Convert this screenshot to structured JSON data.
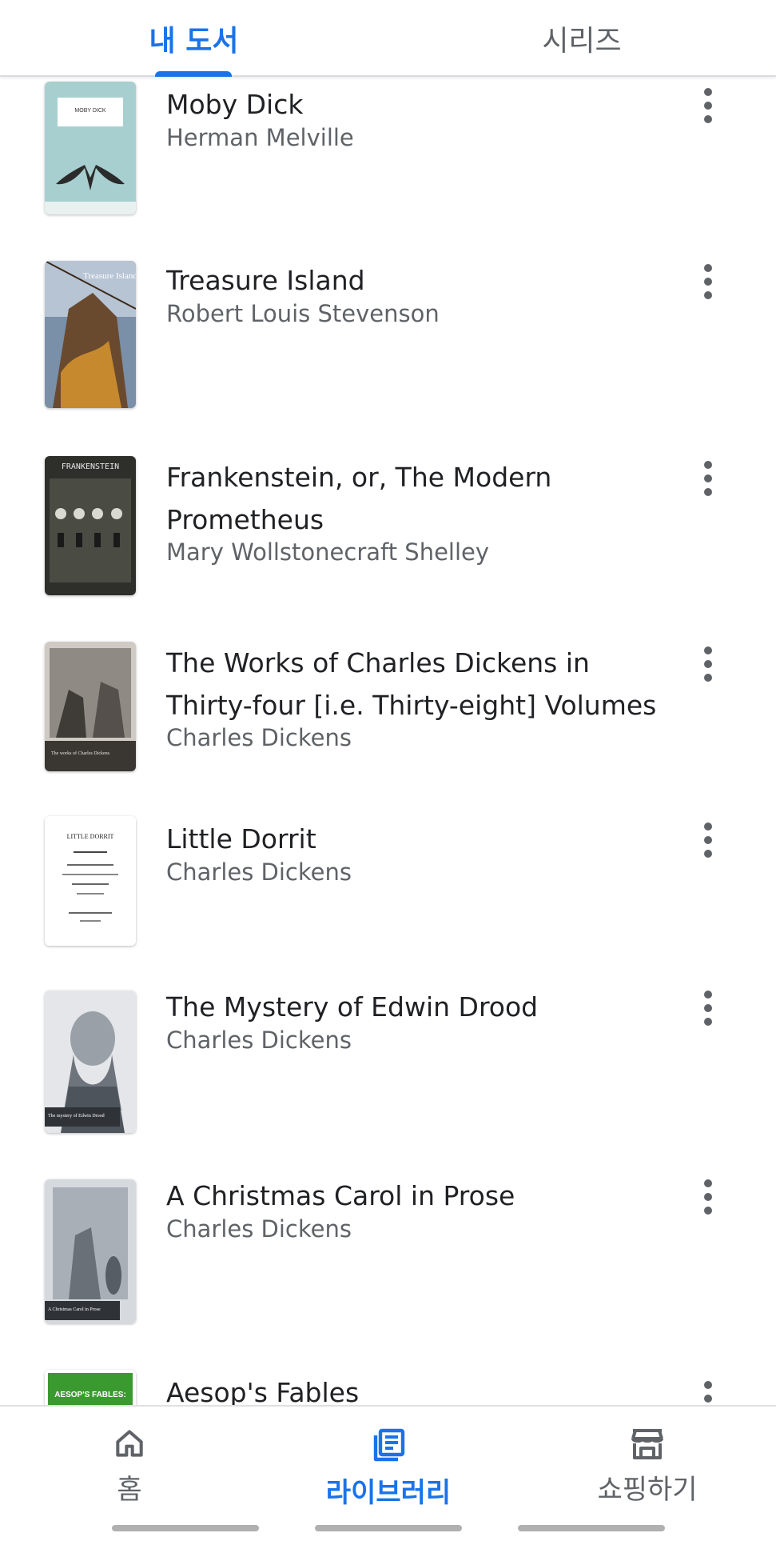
{
  "tabs": {
    "mine": "내 도서",
    "series": "시리즈"
  },
  "books": [
    {
      "title": "Moby Dick",
      "author": "Herman Melville",
      "cover_text": "MOBY DICK"
    },
    {
      "title": "Treasure Island",
      "author": "Robert Louis Stevenson",
      "cover_text": "Treasure Island"
    },
    {
      "title": "Frankenstein, or, The Modern Prometheus",
      "author": "Mary Wollstonecraft Shelley",
      "cover_text": "FRANKENSTEIN"
    },
    {
      "title": "The Works of Charles Dickens in Thirty-four [i.e. Thirty-eight] Volumes",
      "author": "Charles Dickens",
      "cover_text": "The works of Charles Dickens"
    },
    {
      "title": "Little Dorrit",
      "author": "Charles Dickens",
      "cover_text": "LITTLE DORRIT"
    },
    {
      "title": "The Mystery of Edwin Drood",
      "author": "Charles Dickens",
      "cover_text": "The mystery of Edwin Drood"
    },
    {
      "title": "A Christmas Carol in Prose",
      "author": "Charles Dickens",
      "cover_text": "A Christmas Carol in Prose"
    },
    {
      "title": "Aesop's Fables",
      "author": "",
      "cover_text": "AESOP'S FABLES:"
    }
  ],
  "bottom_nav": {
    "home": "홈",
    "library": "라이브러리",
    "shop": "쇼핑하기"
  },
  "colors": {
    "accent": "#1a73e8",
    "text_primary": "#202124",
    "text_secondary": "#5f6368"
  }
}
